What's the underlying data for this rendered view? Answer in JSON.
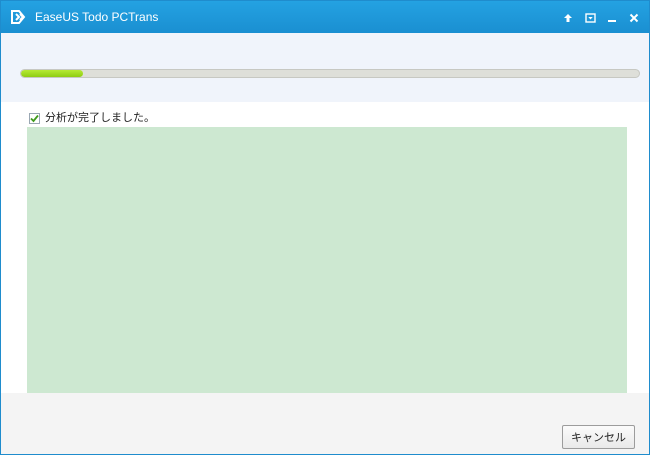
{
  "window": {
    "title": "EaseUS Todo PCTrans",
    "controls": {
      "upload_icon": "arrow-up-icon",
      "menu_icon": "dropdown-menu-icon",
      "minimize_icon": "minimize-icon",
      "close_icon": "close-icon"
    }
  },
  "progress": {
    "value_fraction": 0.1
  },
  "status": {
    "checked": true,
    "text": "分析が完了しました。"
  },
  "footer": {
    "cancel_label": "キャンセル"
  },
  "colors": {
    "titlebar": "#1a8fd1",
    "progress_fill": "#8fcd12",
    "result_panel": "#cde8d1",
    "checkmark": "#3f9b1c"
  }
}
